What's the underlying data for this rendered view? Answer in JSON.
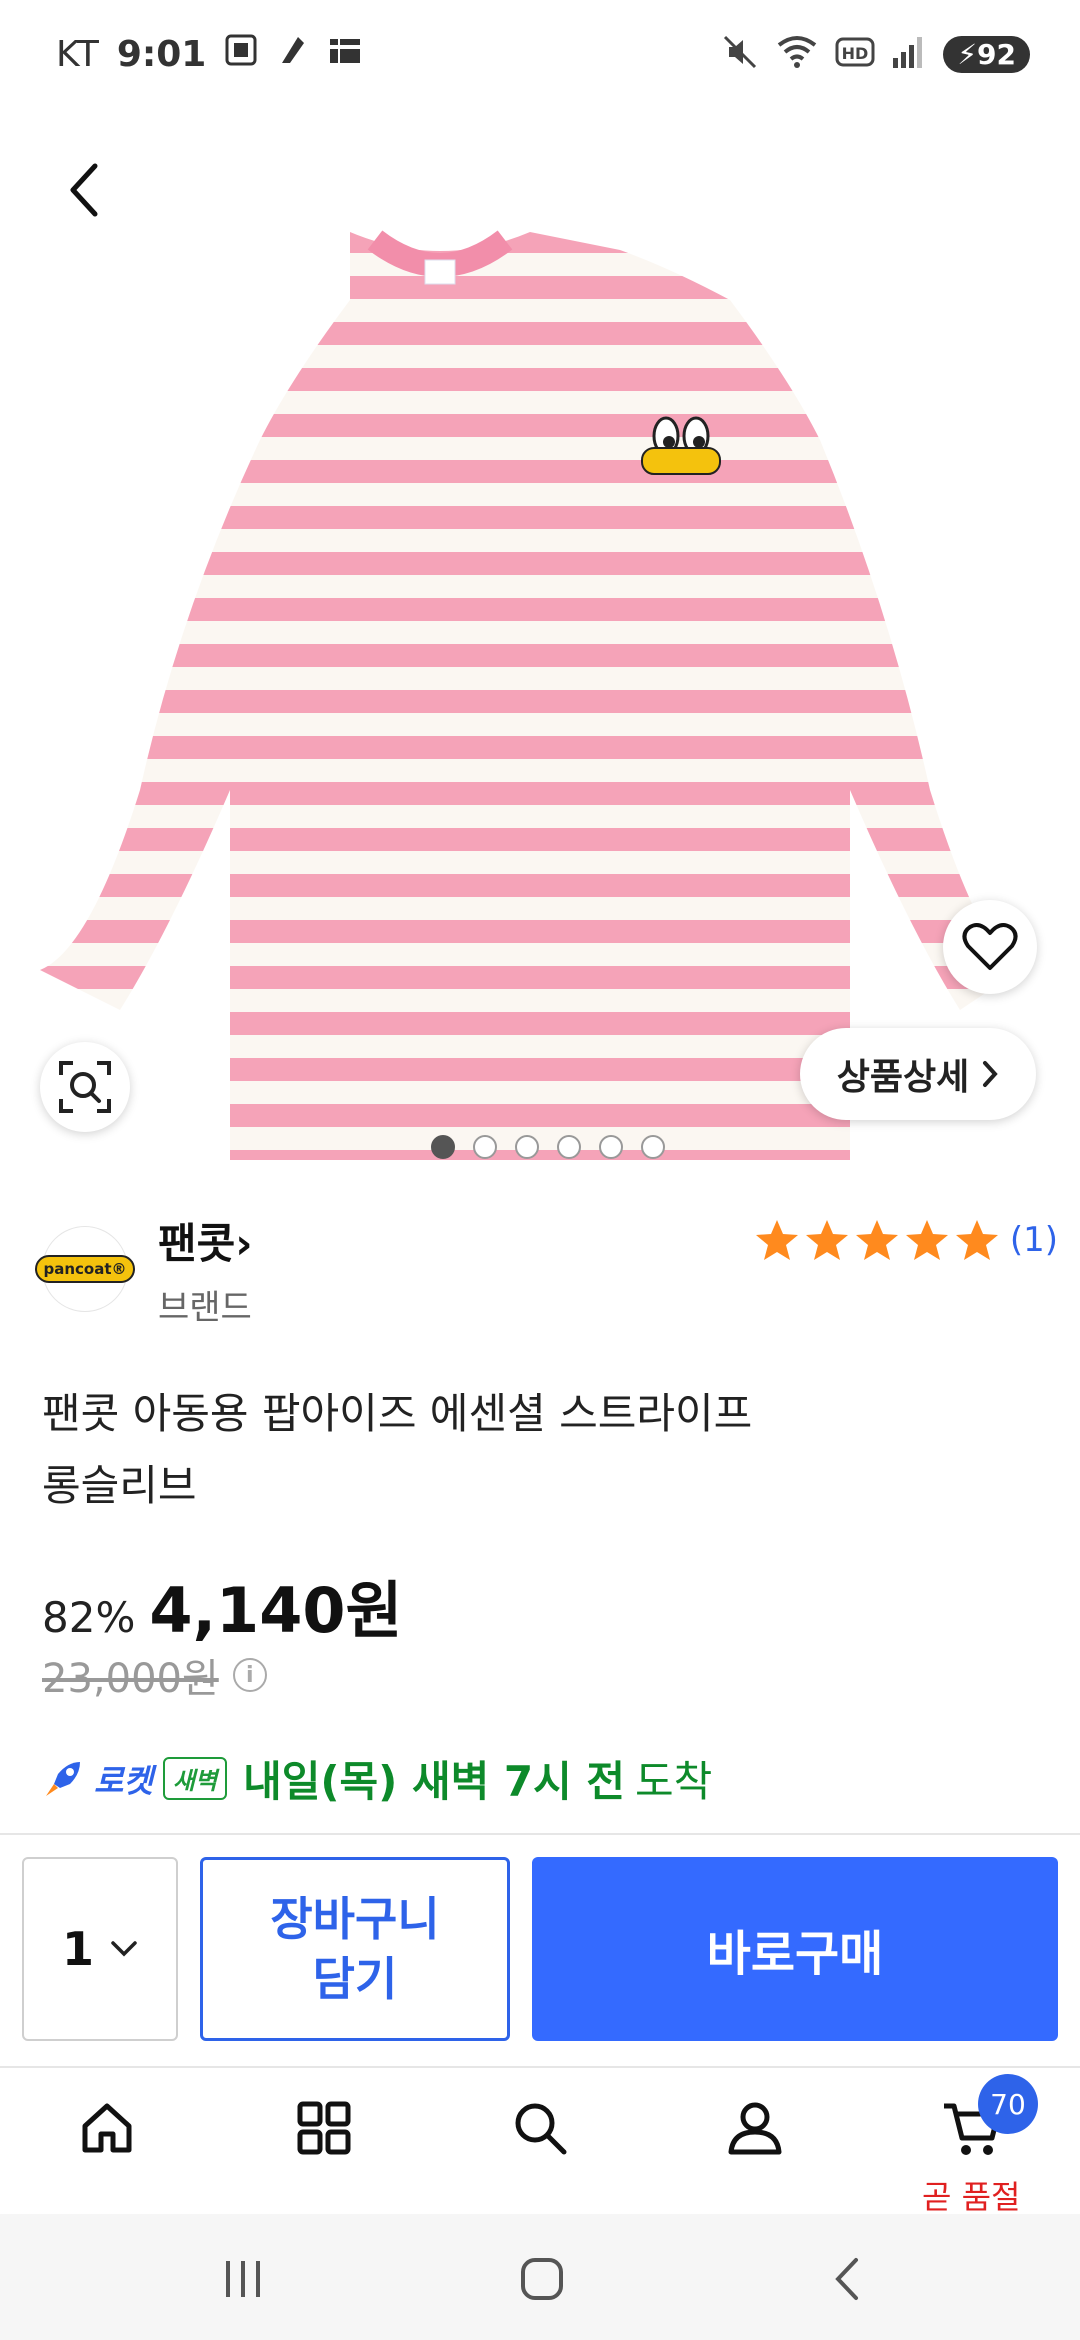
{
  "status_bar": {
    "carrier": "KT",
    "time": "9:01",
    "battery": "92"
  },
  "product": {
    "image_alt_logo": "pancoat",
    "detail_button_label": "상품상세",
    "pager": {
      "count": 6,
      "active_index": 0
    },
    "brand": {
      "logo_text": "pancoat®",
      "name": "팬콧",
      "sub_label": "브랜드"
    },
    "rating": {
      "stars": 5,
      "count_label": "(1)"
    },
    "title_line1": "팬콧 아동용 팝아이즈 에센셜 스트라이프",
    "title_line2": "롱슬리브",
    "discount": "82%",
    "price": "4,140원",
    "original_price": "23,000원",
    "delivery": {
      "rocket_label": "로켓",
      "dawn_badge": "새벽",
      "arrival_strong": "내일(목) 새벽 7시 전",
      "arrival_tail": "도착"
    }
  },
  "actions": {
    "quantity": "1",
    "cart_label": "장바구니\n담기",
    "buy_label": "바로구매"
  },
  "bottom_nav": {
    "items": [
      "home-icon",
      "category-icon",
      "search-icon",
      "my-page-icon",
      "cart-icon"
    ],
    "cart_badge": "70",
    "cart_caption": "곧 품절"
  },
  "colors": {
    "accent": "#346aff",
    "stripe_pink": "#f5a3b8",
    "stripe_white": "#fbf7f2",
    "dawn_green": "#0d8a2a",
    "soldout_red": "#e02020"
  }
}
